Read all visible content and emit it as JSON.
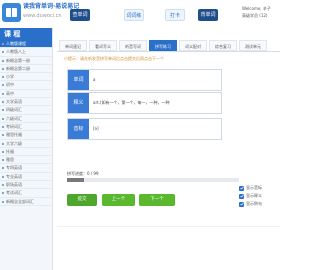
{
  "header": {
    "brand": "读我背单词·易说易记",
    "url": "www.duwoci.cn",
    "nav": [
      "查单词",
      "词词练",
      "打卡",
      "背单词",
      "成长"
    ],
    "welcome_line1": "Welcome, 辛子",
    "welcome_line2": "高级学员 (12)"
  },
  "sidebar": {
    "title": "课 程",
    "items": [
      "人教版课程",
      "人教版八上",
      "新概念第一册",
      "新概念第二册",
      "小学",
      "初中",
      "高中",
      "大学英语",
      "四级词汇",
      "六级词汇",
      "考研词汇",
      "雅思托福",
      "大学六级",
      "托福",
      "雅思",
      "专四英语",
      "专业英语",
      "职场英语",
      "考试词汇",
      "新概念全部词汇"
    ]
  },
  "tabs": [
    "单词速记",
    "看词写义",
    "听音写词",
    "拼写练习",
    "词义配对",
    "综合复习",
    "测试单元"
  ],
  "hint": "小提示：请先听发音拼写单词后点击提交后再点击下一个",
  "fields": [
    {
      "label": "单词",
      "value": "a"
    },
    {
      "label": "释义",
      "value": "art.(如有一个，第一个，每一，一种，一种"
    },
    {
      "label": "音标",
      "value": "[ə]"
    }
  ],
  "progress": {
    "label": "拼写进度：0 / 99",
    "percent": 10
  },
  "actions": [
    "提交",
    "上一个",
    "下一个"
  ],
  "checks": [
    "显示音标",
    "显示释义",
    "显示例句"
  ],
  "colors": {
    "primary": "#2a6fc9",
    "dark_button": "#1f4e8c",
    "green": "#5ab82e",
    "hint": "#d08a2a"
  }
}
